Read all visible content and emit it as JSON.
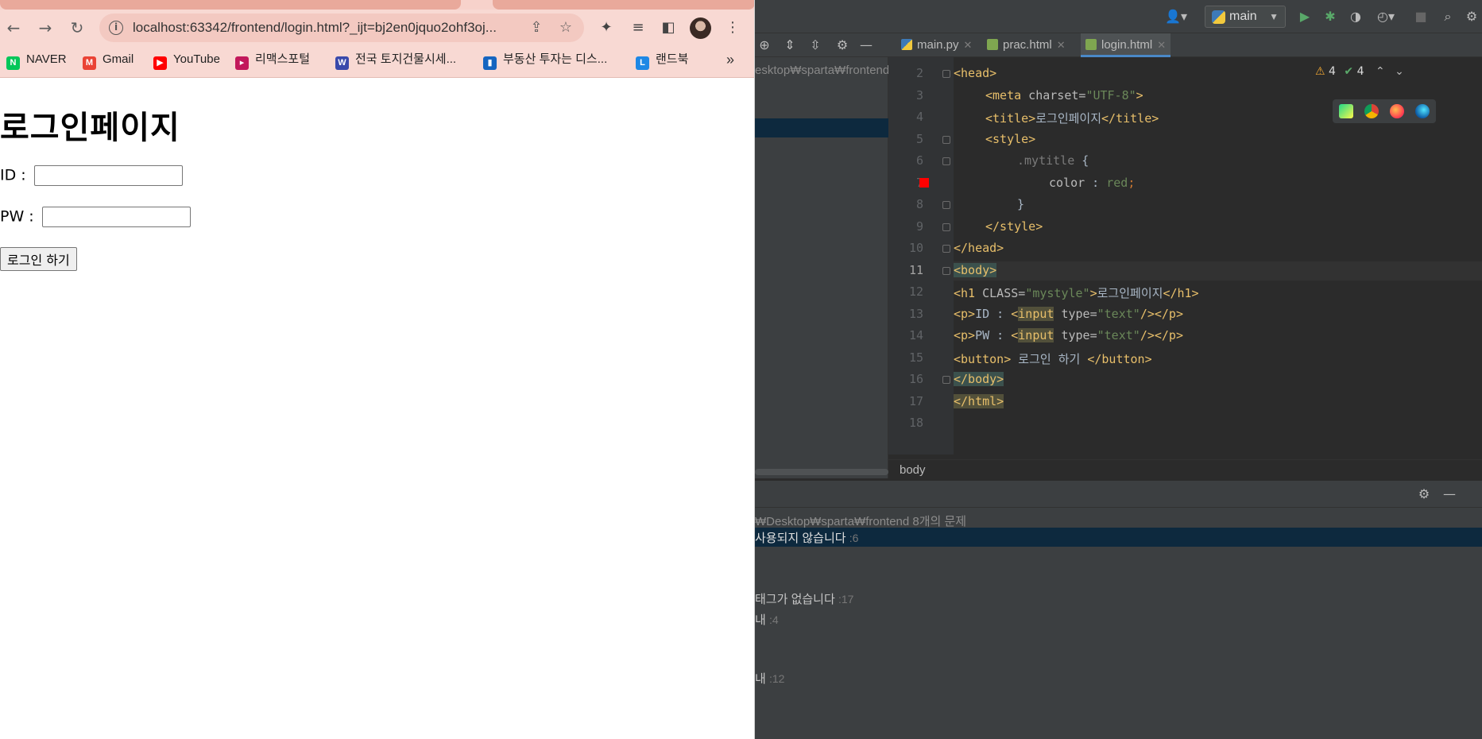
{
  "browser": {
    "url": "localhost:63342/frontend/login.html?_ijt=bj2en0jquo2ohf3oj...",
    "bookmarks": [
      {
        "label": "NAVER",
        "icon": "naver-icon",
        "color": "#03c75a"
      },
      {
        "label": "Gmail",
        "icon": "gmail-icon",
        "color": "#ea4335"
      },
      {
        "label": "YouTube",
        "icon": "youtube-icon",
        "color": "#ff0000"
      },
      {
        "label": "리맥스포털",
        "icon": "remax-icon",
        "color": "#c2185b"
      },
      {
        "label": "전국 토지건물시세...",
        "icon": "land-price-icon",
        "color": "#3949ab"
      },
      {
        "label": "부동산 투자는 디스...",
        "icon": "realestate-chart-icon",
        "color": "#1565c0"
      },
      {
        "label": "랜드북",
        "icon": "landbook-icon",
        "color": "#1e88e5"
      }
    ],
    "bookmarks_more": "»",
    "page": {
      "heading": "로그인페이지",
      "id_label": "ID :",
      "pw_label": "PW :",
      "id_value": "",
      "pw_value": "",
      "button_label": "로그인 하기"
    }
  },
  "ide": {
    "branch": "main",
    "tabs": [
      {
        "label": "main.py",
        "active": false
      },
      {
        "label": "prac.html",
        "active": false
      },
      {
        "label": "login.html",
        "active": true
      }
    ],
    "project_path": "esktop₩sparta₩frontend",
    "inspections": {
      "warnings": "4",
      "weak_warnings": "4"
    },
    "line_numbers": [
      "2",
      "3",
      "4",
      "5",
      "6",
      "7",
      "8",
      "9",
      "10",
      "11",
      "12",
      "13",
      "14",
      "15",
      "16",
      "17",
      "18"
    ],
    "code": {
      "l2": "<head>",
      "l3_tag_open": "<meta",
      "l3_attr": " charset=",
      "l3_val": "\"UTF-8\"",
      "l3_close": ">",
      "l4_open": "<title>",
      "l4_text": "로그인페이지",
      "l4_close": "</title>",
      "l5": "<style>",
      "l6_sel": ".mytitle",
      "l6_brace": " {",
      "l7_prop": "color",
      "l7_colon": " : ",
      "l7_val": "red",
      "l7_semi": ";",
      "l8": "}",
      "l9": "</style>",
      "l10": "</head>",
      "l11": "<body>",
      "l12_open": "<h1",
      "l12_attr": " CLASS=",
      "l12_val": "\"mystyle\"",
      "l12_gt": ">",
      "l12_text": "로그인페이지",
      "l12_close": "</h1>",
      "l13_p": "<p>",
      "l13_text": "ID : ",
      "l13_input_lt": "<",
      "l13_input": "input",
      "l13_attr": " type=",
      "l13_val": "\"text\"",
      "l13_end": "/></p>",
      "l14_p": "<p>",
      "l14_text": "PW : ",
      "l14_input_lt": "<",
      "l14_input": "input",
      "l14_attr": " type=",
      "l14_val": "\"text\"",
      "l14_end": "/></p>",
      "l15_open": "<button>",
      "l15_text": " 로그인 하기 ",
      "l15_close": "</button>",
      "l16": "</body>",
      "l17": "</html>"
    },
    "breadcrumb": "body",
    "problems": {
      "path": "₩Desktop₩sparta₩frontend  8개의 문제",
      "items": [
        {
          "text": "사용되지 않습니다",
          "line": ":6",
          "selected": true
        },
        {
          "text": "태그가 없습니다",
          "line": ":17",
          "selected": false
        },
        {
          "text": "내",
          "line": ":4",
          "selected": false
        },
        {
          "text": "내",
          "line": ":12",
          "selected": false
        }
      ]
    }
  }
}
